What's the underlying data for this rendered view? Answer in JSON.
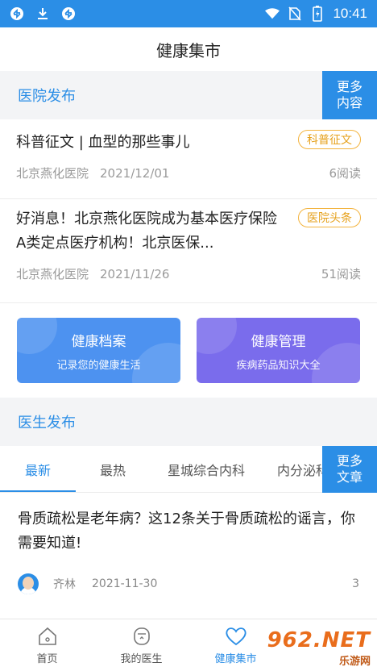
{
  "status_bar": {
    "time": "10:41",
    "icons": [
      "sync-icon",
      "download-icon",
      "sync-icon",
      "wifi-icon",
      "no-sim-icon",
      "battery-icon"
    ]
  },
  "header": {
    "title": "健康集市"
  },
  "hospital_section": {
    "title": "医院发布",
    "more_line1": "更多",
    "more_line2": "内容",
    "items": [
      {
        "title": "科普征文 | 血型的那些事儿",
        "tag": "科普征文",
        "source": "北京燕化医院",
        "date": "2021/12/01",
        "reads": "6阅读"
      },
      {
        "title": "好消息！北京燕化医院成为基本医疗保险A类定点医疗机构！北京医保...",
        "tag": "医院头条",
        "source": "北京燕化医院",
        "date": "2021/11/26",
        "reads": "51阅读"
      }
    ]
  },
  "cards": [
    {
      "title": "健康档案",
      "subtitle": "记录您的健康生活"
    },
    {
      "title": "健康管理",
      "subtitle": "疾病药品知识大全"
    }
  ],
  "doctor_section": {
    "title": "医生发布",
    "more_line1": "更多",
    "more_line2": "文章",
    "tabs": [
      "最新",
      "最热",
      "星城综合内科",
      "内分泌科"
    ],
    "article": {
      "title": "骨质疏松是老年病？这12条关于骨质疏松的谣言，你需要知道!",
      "author": "齐林",
      "date": "2021-11-30",
      "count": "3"
    }
  },
  "bottom_nav": [
    {
      "label": "首页",
      "icon": "home-icon"
    },
    {
      "label": "我的医生",
      "icon": "doctor-icon"
    },
    {
      "label": "健康集市",
      "icon": "heart-icon"
    }
  ],
  "watermark": {
    "top": "962.NET",
    "bottom": "乐游网"
  },
  "colors": {
    "accent": "#2b8ee6",
    "tag": "#e6a11c",
    "card_blue": "#4d92f0",
    "card_purple": "#7a6cec"
  }
}
